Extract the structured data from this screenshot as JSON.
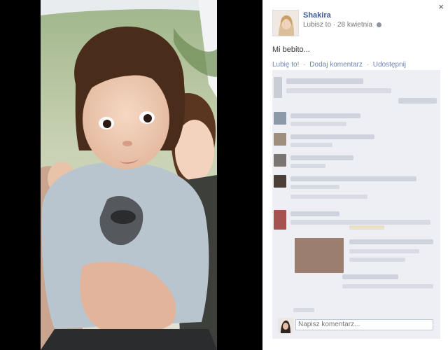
{
  "viewer": {
    "close_icon": "×"
  },
  "post": {
    "page_name": "Shakira",
    "like_page": "Lubisz to",
    "separator": "·",
    "date": "28 kwietnia",
    "privacy_icon": "globe-icon",
    "caption": "Mi bebito..."
  },
  "actions": {
    "like": "Lubię to!",
    "comment": "Dodaj komentarz",
    "share": "Udostępnij",
    "sep": "·"
  },
  "composer": {
    "placeholder": "Napisz komentarz..."
  },
  "colors": {
    "link": "#3b5998",
    "feed_bg": "#edeff4",
    "muted_link": "#6d84b4"
  }
}
